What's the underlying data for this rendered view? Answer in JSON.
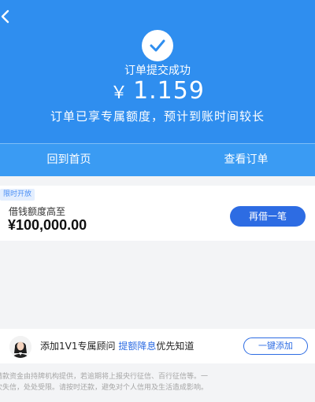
{
  "hero": {
    "title": "订单提交成功",
    "currency": "￥",
    "amount": "1.159",
    "subtitle": "订单已享专属额度，预计到账时间较长"
  },
  "actions": {
    "home_label": "回到首页",
    "orders_label": "查看订单"
  },
  "loan": {
    "badge": "限时开放",
    "label": "借钱额度高至",
    "amount": "¥100,000.00",
    "button": "再借一笔"
  },
  "advisor": {
    "text_prefix": "添加1V1专属顾问",
    "highlight": "提额降息",
    "text_suffix": "优先知道",
    "button": "一键添加"
  },
  "disclaimer": {
    "line1": "借款资金由持牌机构提供，若逾期将上报央行征信、百行征信等。一",
    "line2": "次失信，处处受限。请按时还款，避免对个人信用及生活造成影响。"
  },
  "colors": {
    "primary": "#2f8eef",
    "accent": "#2d6ce3"
  },
  "icons": {
    "back": "chevron-left-icon",
    "success": "check-icon"
  }
}
